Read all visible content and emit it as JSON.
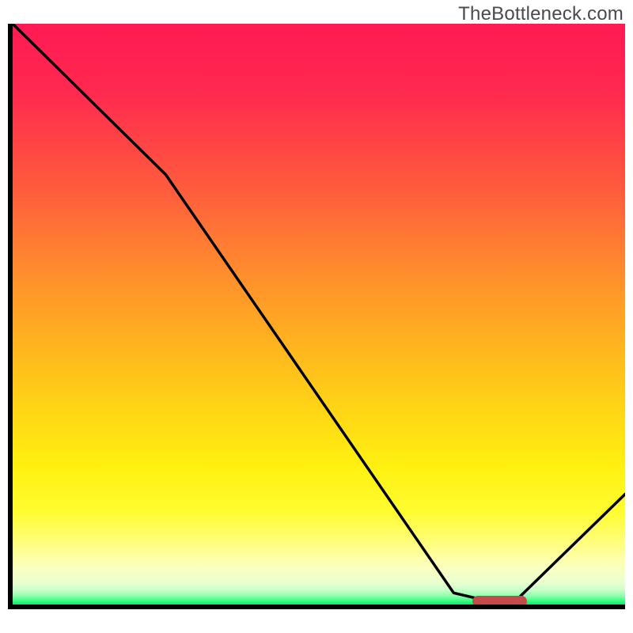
{
  "watermark": "TheBottleneck.com",
  "chart_data": {
    "type": "line",
    "title": "",
    "xlabel": "",
    "ylabel": "",
    "xlim": [
      0,
      100
    ],
    "ylim": [
      0,
      100
    ],
    "x": [
      0,
      25,
      72,
      78,
      82,
      100
    ],
    "values": [
      100,
      74,
      2,
      0.5,
      0.5,
      19
    ],
    "gradient_stops": [
      {
        "pos": 0.0,
        "color": "#ff1a53"
      },
      {
        "pos": 0.5,
        "color": "#ffb31f"
      },
      {
        "pos": 0.85,
        "color": "#fffc30"
      },
      {
        "pos": 1.0,
        "color": "#11e574"
      }
    ],
    "marker": {
      "x_start": 75,
      "x_end": 84,
      "y": 0.5,
      "color": "#c54b4b"
    }
  }
}
